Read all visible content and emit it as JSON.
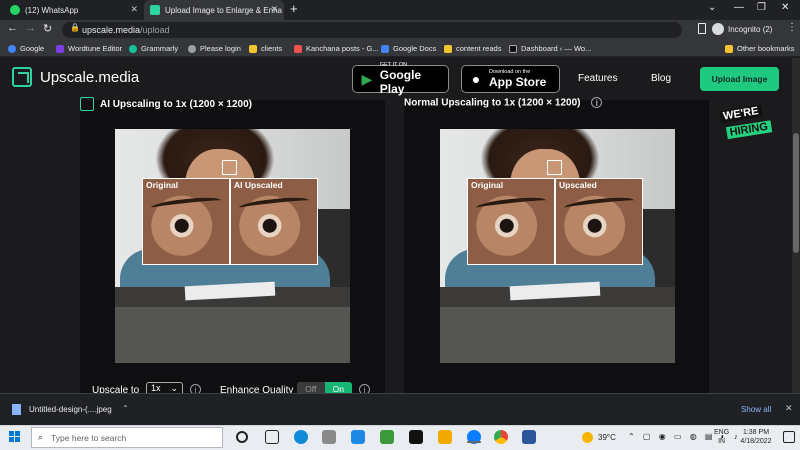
{
  "browser": {
    "tabs": [
      {
        "label": "(12) WhatsApp",
        "favicon_color": "#25d366"
      },
      {
        "label": "Upload Image to Enlarge & Enha",
        "favicon_color": "#2dd4a0"
      }
    ],
    "new_tab_label": "+",
    "url_host": "upscale.media",
    "url_path": "/upload",
    "incognito_label": "Incognito (2)",
    "bookmarks": [
      {
        "label": "Google",
        "color": "#4285f4"
      },
      {
        "label": "Wordtune Editor",
        "color": "#7b3fe4"
      },
      {
        "label": "Grammarly",
        "color": "#15c39a"
      },
      {
        "label": "Please login",
        "color": "#9aa0a6"
      },
      {
        "label": "clients",
        "color": "#f4c430"
      },
      {
        "label": "Kanchana posts - G...",
        "color": "#ef5350"
      },
      {
        "label": "Google Docs",
        "color": "#4285f4"
      },
      {
        "label": "content reads",
        "color": "#f4c430"
      },
      {
        "label": "Dashboard ‹ — Wo...",
        "color": "#111111"
      }
    ],
    "other_bookmarks": "Other bookmarks"
  },
  "site": {
    "logo": "Upscale.media",
    "google_play": {
      "small": "GET IT ON",
      "big": "Google Play"
    },
    "app_store": {
      "small": "Download on the",
      "big": "App Store"
    },
    "nav": {
      "features": "Features",
      "blog": "Blog",
      "upload": "Upload Image"
    },
    "accent_color": "#1fc980",
    "hiring_line1": "WE'RE",
    "hiring_line2": "HIRING"
  },
  "comparison": {
    "ai_title": "AI Upscaling to 1x (1200 × 1200)",
    "normal_title": "Normal Upscaling to 1x (1200 × 1200)",
    "info_icon": "i",
    "left_crops": [
      "Original",
      "AI Upscaled"
    ],
    "right_crops": [
      "Original",
      "Upscaled"
    ]
  },
  "controls": {
    "upscale_label": "Upscale to",
    "upscale_value": "1x",
    "enhance_label": "Enhance Quality",
    "toggle_off": "Off",
    "toggle_on": "On"
  },
  "download": {
    "file_name": "Untitled-design-(....jpeg",
    "show_all": "Show all"
  },
  "taskbar": {
    "search_placeholder": "Type here to search",
    "temperature": "39°C",
    "lang_line1": "ENG",
    "lang_line2": "IN",
    "time": "1:38 PM",
    "date": "4/18/2022"
  }
}
